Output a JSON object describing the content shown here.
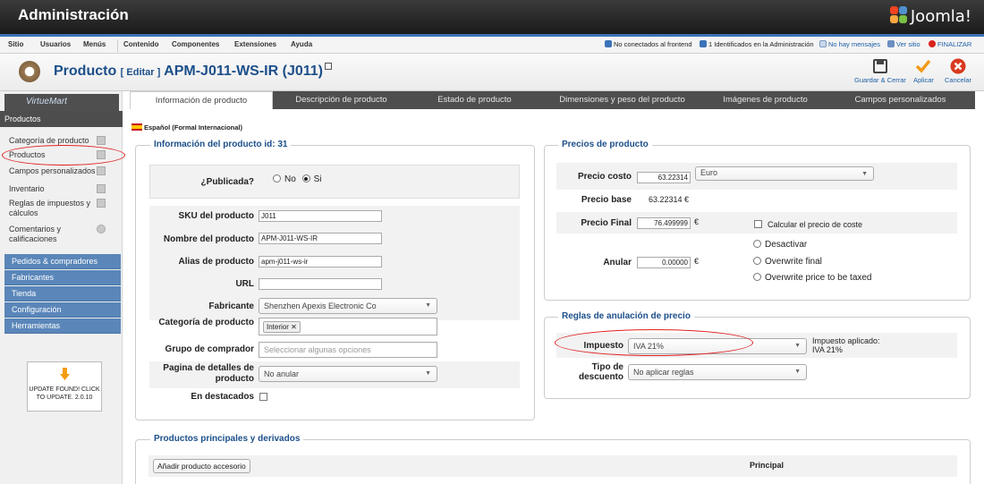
{
  "header": {
    "title": "Administración",
    "brand": "Joomla!"
  },
  "menubar": {
    "items": [
      "Sitio",
      "Usuarios",
      "Menús",
      "Contenido",
      "Componentes",
      "Extensiones",
      "Ayuda"
    ],
    "status": {
      "frontend": "No conectados al frontend",
      "admin": "1 Identificados en la Administración",
      "messages": "No hay mensajes",
      "view_site": "Ver sitio",
      "logout": "FINALIZAR"
    }
  },
  "toolbar": {
    "product_label": "Producto",
    "edit_label": "[ Editar ]",
    "product_name": "APM-J011-WS-IR (J011)",
    "save_close": "Guardar & Cerrar",
    "apply": "Aplicar",
    "cancel": "Cancelar"
  },
  "sidebar": {
    "logo": "VirtueMart",
    "section": "Productos",
    "items": [
      {
        "label": "Categoría de producto"
      },
      {
        "label": "Productos"
      },
      {
        "label": "Campos personalizados"
      },
      {
        "label": "Inventario"
      },
      {
        "label": "Reglas de impuestos y cálculos"
      },
      {
        "label": "Comentarios y calificaciones"
      }
    ],
    "groups": [
      "Pedidos & compradores",
      "Fabricantes",
      "Tienda",
      "Configuración",
      "Herramientas"
    ],
    "update": "UPDATE FOUND! CLICK TO UPDATE. 2.0.10"
  },
  "tabs": [
    "Información de producto",
    "Descripción de producto",
    "Estado de producto",
    "Dimensiones y peso del producto",
    "Imágenes de producto",
    "Campos personalizados"
  ],
  "language": "Español (Formal Internacional)",
  "info": {
    "legend": "Información del producto id: 31",
    "published_label": "¿Publicada?",
    "no": "No",
    "yes": "Si",
    "sku_label": "SKU del producto",
    "sku": "J011",
    "name_label": "Nombre del producto",
    "name": "APM-J011-WS-IR",
    "alias_label": "Alias de producto",
    "alias": "apm-j011-ws-ir",
    "url_label": "URL",
    "url": "",
    "manufacturer_label": "Fabricante",
    "manufacturer": "Shenzhen Apexis Electronic Co",
    "category_label": "Categoría de producto",
    "category_tag": "Interior",
    "group_label": "Grupo de comprador",
    "group_placeholder": "Seleccionar algunas opciones",
    "details_label": "Pagina de detalles de producto",
    "details": "No anular",
    "featured_label": "En destacados"
  },
  "prices": {
    "legend": "Precios de producto",
    "cost_label": "Precio costo",
    "cost": "63.22314",
    "currency": "Euro",
    "base_label": "Precio base",
    "base": "63.22314 €",
    "final_label": "Precio Final",
    "final": "76.499999",
    "euro": "€",
    "calc_label": "Calcular el precio de coste",
    "override_label": "Anular",
    "override": "0.00000",
    "opt_disable": "Desactivar",
    "opt_overwrite": "Overwrite final",
    "opt_taxed": "Overwrite price to be taxed"
  },
  "rules": {
    "legend": "Reglas de anulación de precio",
    "tax_label": "Impuesto",
    "tax": "IVA 21%",
    "tax_applied_label": "Impuesto aplicado:",
    "tax_applied": "IVA 21%",
    "discount_label": "Tipo de descuento",
    "discount": "No aplicar reglas"
  },
  "related": {
    "legend": "Productos principales y derivados",
    "add_button": "Añadir producto accesorio",
    "col_principal": "Principal"
  }
}
